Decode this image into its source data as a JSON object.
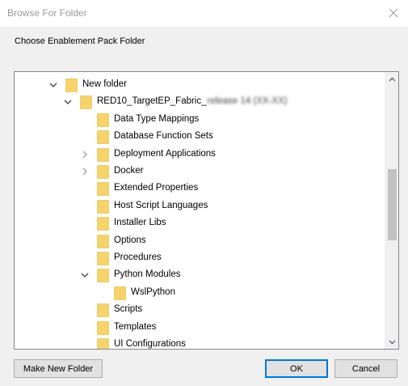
{
  "window": {
    "title": "Browse For Folder",
    "close_icon": "close-icon"
  },
  "prompt": "Choose Enablement Pack Folder",
  "tree": {
    "items": [
      {
        "label": "New folder",
        "level": 0,
        "toggle": "expanded"
      },
      {
        "label": "RED10_TargetEP_Fabric_",
        "label_obscured": "release 14 (XX-XX)",
        "level": 1,
        "toggle": "expanded"
      },
      {
        "label": "Data Type Mappings",
        "level": 2,
        "toggle": "none"
      },
      {
        "label": "Database Function Sets",
        "level": 2,
        "toggle": "none"
      },
      {
        "label": "Deployment Applications",
        "level": 2,
        "toggle": "collapsed"
      },
      {
        "label": "Docker",
        "level": 2,
        "toggle": "collapsed"
      },
      {
        "label": "Extended Properties",
        "level": 2,
        "toggle": "none"
      },
      {
        "label": "Host Script Languages",
        "level": 2,
        "toggle": "none"
      },
      {
        "label": "Installer Libs",
        "level": 2,
        "toggle": "none"
      },
      {
        "label": "Options",
        "level": 2,
        "toggle": "none"
      },
      {
        "label": "Procedures",
        "level": 2,
        "toggle": "none"
      },
      {
        "label": "Python Modules",
        "level": 2,
        "toggle": "expanded"
      },
      {
        "label": "WslPython",
        "level": 3,
        "toggle": "none"
      },
      {
        "label": "Scripts",
        "level": 2,
        "toggle": "none"
      },
      {
        "label": "Templates",
        "level": 2,
        "toggle": "none"
      },
      {
        "label": "UI Configurations",
        "level": 2,
        "toggle": "none"
      }
    ],
    "folder_icon": "folder-icon"
  },
  "buttons": {
    "make_new_folder": "Make New Folder",
    "ok": "OK",
    "cancel": "Cancel"
  },
  "colors": {
    "folder": "#f6d36b",
    "accent": "#0078d7",
    "thumb": "#c2c2c2"
  }
}
